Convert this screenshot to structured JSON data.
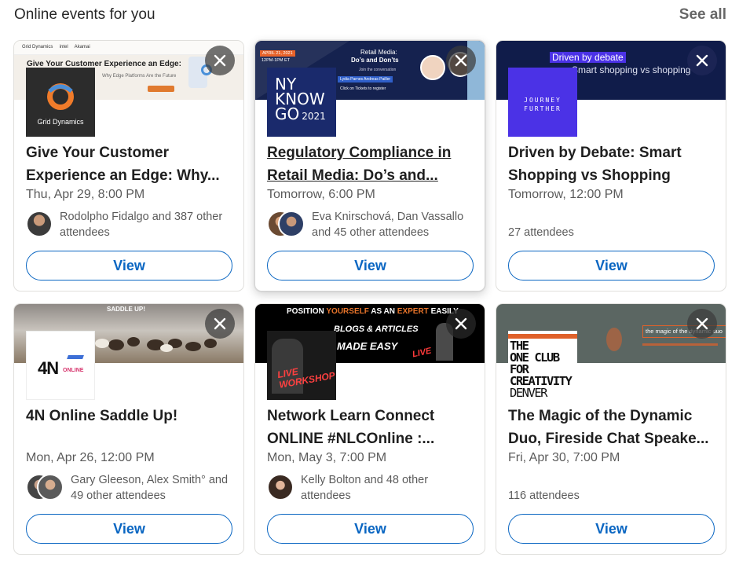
{
  "header": {
    "title": "Online events for you",
    "see_all": "See all"
  },
  "cards": [
    {
      "title": "Give Your Customer Experience an Edge: Why...",
      "time": "Thu, Apr 29, 8:00 PM",
      "attendees": "Rodolpho Fidalgo and 387 other attendees",
      "view": "View",
      "banner_text": "Give Your Customer Experience an Edge:",
      "banner_sub": "Why Edge Platforms Are the Future",
      "logo_text": "Grid Dynamics"
    },
    {
      "title": "Regulatory Compliance in Retail Media: Do’s and...",
      "time": "Tomorrow, 6:00 PM",
      "attendees": "Eva Knirschová, Dan Vassallo and 45 other attendees",
      "view": "View",
      "banner_date": "APRIL 21, 2021",
      "banner_time": "12PM-1PM ET",
      "banner_title": "Retail Media:",
      "banner_title2": "Do’s and Don’ts",
      "banner_join": "Join the conversation",
      "banner_names": "Lydia Parnes   Andreas Pailler",
      "banner_register": "Click on Tickets to register",
      "logo_lines": [
        "NY",
        "KNOW",
        "GO",
        "2021"
      ]
    },
    {
      "title": "Driven by Debate: Smart Shopping vs Shopping",
      "time": "Tomorrow, 12:00 PM",
      "attendees": "27 attendees",
      "view": "View",
      "banner_tag": "Driven by debate",
      "banner_sub": "Smart shopping vs shopping",
      "logo_lines": [
        "JOURNEY",
        "FURTHER"
      ]
    },
    {
      "title": "4N Online Saddle Up!",
      "time": "Mon, Apr 26, 12:00 PM",
      "attendees": "Gary Gleeson, Alex Smith° and 49 other attendees",
      "view": "View",
      "banner_text": "SADDLE UP!",
      "logo_main": "4N",
      "logo_sub": "ONLINE"
    },
    {
      "title": "Network Learn Connect ONLINE #NLCOnline :...",
      "time": "Mon, May 3, 7:00 PM",
      "attendees": "Kelly Bolton and 48 other attendees",
      "view": "View",
      "banner_pre": "POSITION ",
      "banner_hl1": "YOURSELF",
      "banner_mid": " AS AN ",
      "banner_hl2": "EXPERT",
      "banner_post": " EASILY",
      "banner_blogs": "BLOGS & ARTICLES",
      "banner_made": "MADE EASY",
      "banner_live": "LIVE",
      "logo_workshop": "LIVE WORKSHOP"
    },
    {
      "title": "The Magic of the Dynamic Duo, Fireside Chat Speake...",
      "time": "Fri, Apr 30, 7:00 PM",
      "attendees": "116 attendees",
      "view": "View",
      "banner_text": "the magic of the dynamic duo",
      "logo_lines": [
        "THE",
        "ONE CLUB",
        "FOR",
        "CREATIVITY",
        "DENVER"
      ]
    }
  ],
  "icons": {
    "close": "close-icon"
  },
  "colors": {
    "accent": "#0a66c2",
    "border": "#e0dfdc"
  }
}
